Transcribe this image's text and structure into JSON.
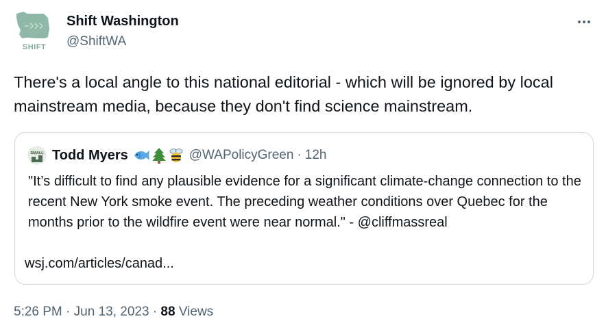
{
  "tweet": {
    "author_name": "Shift Washington",
    "author_handle": "@ShiftWA",
    "avatar_label": "SHIFT",
    "text": "There's a local angle to this national editorial - which will be ignored by local mainstream media, because they don't find science mainstream.",
    "more_icon": "more-horizontal-icon"
  },
  "quote": {
    "author_name": "Todd Myers",
    "author_emojis": [
      "fish-emoji",
      "evergreen-tree-emoji",
      "bee-emoji"
    ],
    "author_handle": "@WAPolicyGreen",
    "separator": "·",
    "time": "12h",
    "avatar_label": "SMALL",
    "text": "\"It’s difficult to find any plausible evidence for a significant climate-change connection to the recent New York smoke event. The preceding weather conditions over Quebec for the months prior to the wildfire event were near normal.\" - @cliffmassreal",
    "link": "wsj.com/articles/canad..."
  },
  "meta": {
    "time": "5:26 PM",
    "separator": "·",
    "date": "Jun 13, 2023",
    "views_count": "88",
    "views_label": "Views"
  },
  "colors": {
    "text_primary": "#0f1419",
    "text_secondary": "#536471",
    "border": "#cfd9de",
    "avatar_green": "#8fb8a8"
  }
}
